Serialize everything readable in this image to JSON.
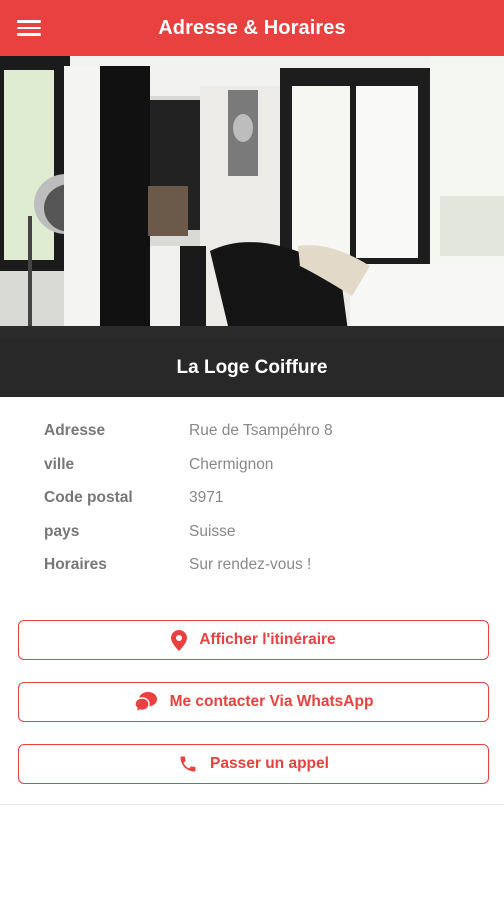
{
  "header": {
    "title": "Adresse & Horaires",
    "menu_icon": "hamburger-menu-icon"
  },
  "hero": {
    "caption": "La Loge Coiffure"
  },
  "info": {
    "rows": [
      {
        "label": "Adresse",
        "value": "Rue de Tsampéhro 8"
      },
      {
        "label": "ville",
        "value": "Chermignon"
      },
      {
        "label": "Code postal",
        "value": "3971"
      },
      {
        "label": "pays",
        "value": "Suisse"
      },
      {
        "label": "Horaires",
        "value": "Sur rendez-vous !"
      }
    ]
  },
  "actions": {
    "route": {
      "label": "Afficher l'itinéraire",
      "icon": "map-pin-icon"
    },
    "whatsapp": {
      "label": "Me contacter Via WhatsApp",
      "icon": "chat-bubble-icon"
    },
    "call": {
      "label": "Passer un appel",
      "icon": "phone-icon"
    }
  },
  "colors": {
    "accent": "#e8413f",
    "label": "#777777",
    "value": "#888888"
  }
}
